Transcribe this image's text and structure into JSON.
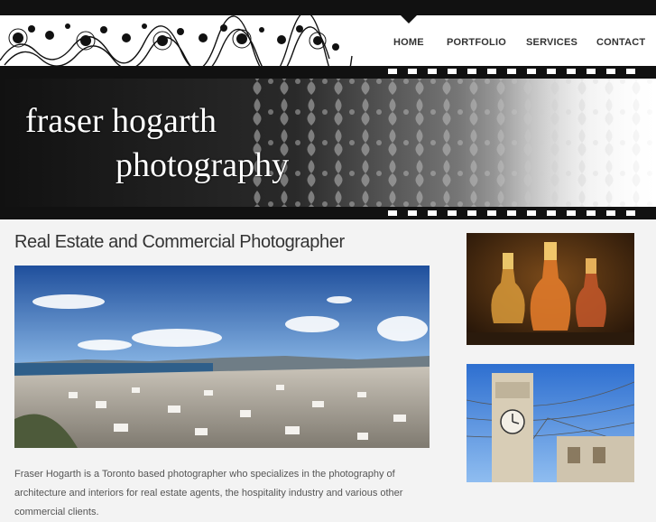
{
  "nav": {
    "items": [
      {
        "label": "HOME",
        "active": true
      },
      {
        "label": "PORTFOLIO",
        "active": false
      },
      {
        "label": "SERVICES",
        "active": false
      },
      {
        "label": "CONTACT",
        "active": false
      }
    ]
  },
  "brand": {
    "line1": "fraser hogarth",
    "line2": "photography"
  },
  "main": {
    "heading": "Real Estate and Commercial Photographer",
    "intro": "Fraser Hogarth is a Toronto based photographer who specializes in the photography of architecture and interiors for real estate agents, the hospitality industry and various other commercial clients."
  },
  "images": {
    "hero": "panoramic-town-sea-photo",
    "thumb1": "glass-decanters-photo",
    "thumb2": "clock-tower-photo"
  },
  "colors": {
    "topbar": "#111111",
    "page_bg": "#f3f3f3",
    "nav_text": "#333333",
    "heading": "#333333",
    "body_text": "#555555"
  }
}
